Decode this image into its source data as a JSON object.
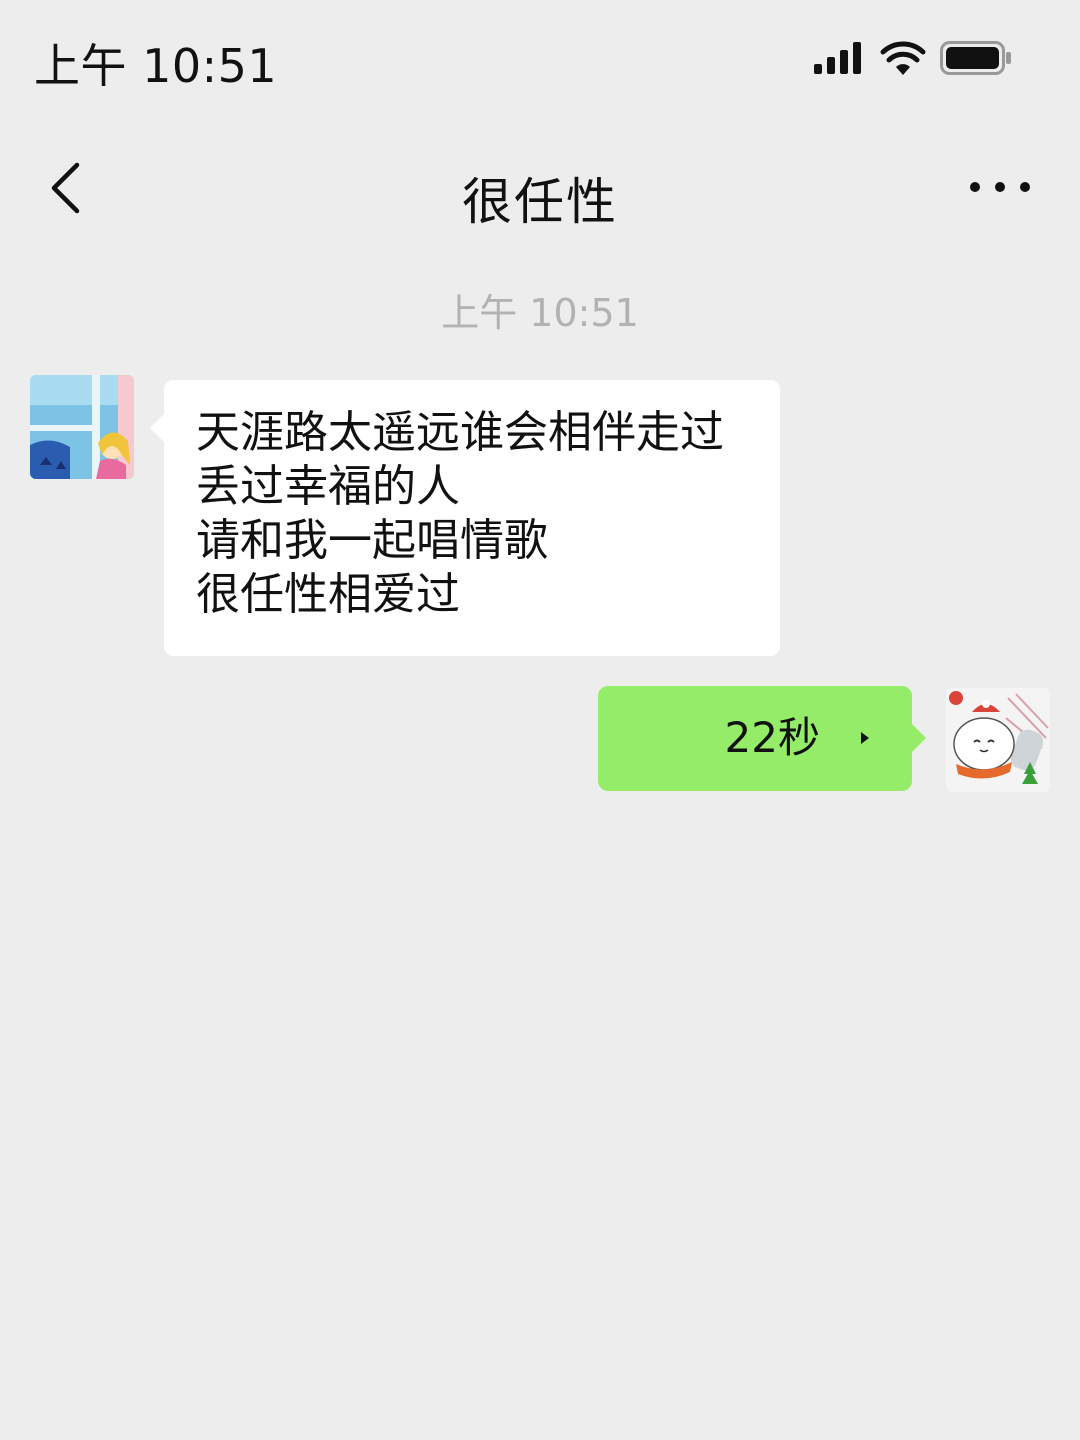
{
  "status_bar": {
    "time": "上午 10:51",
    "signal_icon": "signal-bars-icon",
    "wifi_icon": "wifi-icon",
    "battery_icon": "battery-icon"
  },
  "nav": {
    "back_icon": "chevron-left-icon",
    "title": "很任性",
    "more_icon": "more-dots-icon"
  },
  "chat": {
    "timestamp": "上午 10:51",
    "messages": [
      {
        "direction": "incoming",
        "type": "text",
        "lines": [
          "天涯路太遥远谁会相伴走过",
          "丢过幸福的人",
          "请和我一起唱情歌",
          "很任性相爱过"
        ]
      },
      {
        "direction": "outgoing",
        "type": "voice",
        "duration": "22秒"
      }
    ]
  },
  "colors": {
    "background": "#ededed",
    "incoming_bubble": "#ffffff",
    "outgoing_bubble": "#95ec69",
    "timestamp_text": "#b2b2b2"
  }
}
